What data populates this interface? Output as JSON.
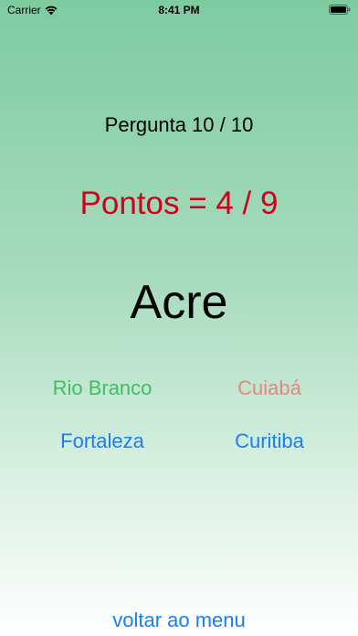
{
  "status_bar": {
    "carrier": "Carrier",
    "time": "8:41 PM"
  },
  "quiz": {
    "question_label": "Pergunta 10 / 10",
    "score_label": "Pontos = 4 / 9",
    "state_name": "Acre",
    "answers": [
      {
        "label": "Rio Branco",
        "color": "#3fbf5f"
      },
      {
        "label": "Cuiabá",
        "color": "#df8a7c"
      },
      {
        "label": "Fortaleza",
        "color": "#1a7ff0"
      },
      {
        "label": "Curitiba",
        "color": "#1a7ff0"
      }
    ]
  },
  "footer": {
    "menu_link": "voltar ao menu"
  },
  "colors": {
    "score": "#d0021b",
    "link": "#1a7ff0"
  }
}
